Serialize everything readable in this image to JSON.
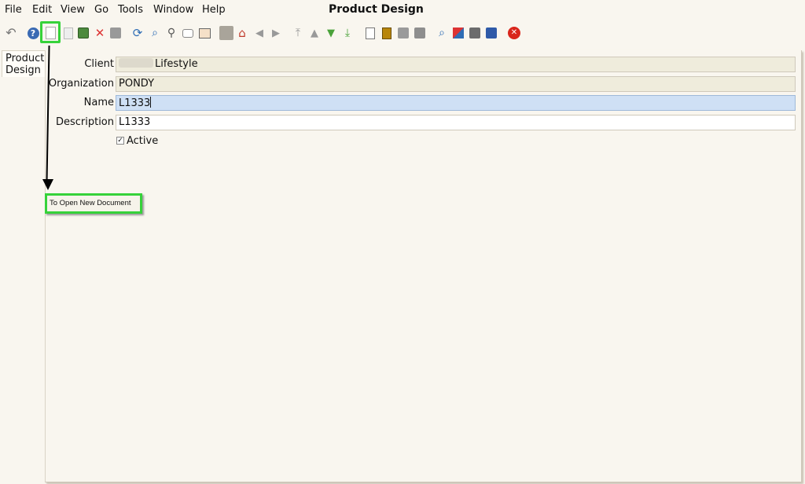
{
  "window": {
    "title": "Product Design"
  },
  "menubar": {
    "file": "File",
    "edit": "Edit",
    "view": "View",
    "go": "Go",
    "tools": "Tools",
    "window": "Window",
    "help": "Help"
  },
  "tab": {
    "label_line1": "Product",
    "label_line2": "Design"
  },
  "form": {
    "client_label": "Client",
    "client_value": "Lifestyle",
    "organization_label": "Organization",
    "organization_value": "PONDY",
    "name_label": "Name",
    "name_value": "L1333",
    "description_label": "Description",
    "description_value": "L1333",
    "active_label": "Active",
    "active_checked": true
  },
  "annotation": {
    "callout_text": "To Open New Document"
  },
  "colors": {
    "highlight": "#36d23a",
    "focus_field": "#cfe0f5",
    "readonly_field": "#efecdc",
    "background": "#f9f6ef"
  }
}
